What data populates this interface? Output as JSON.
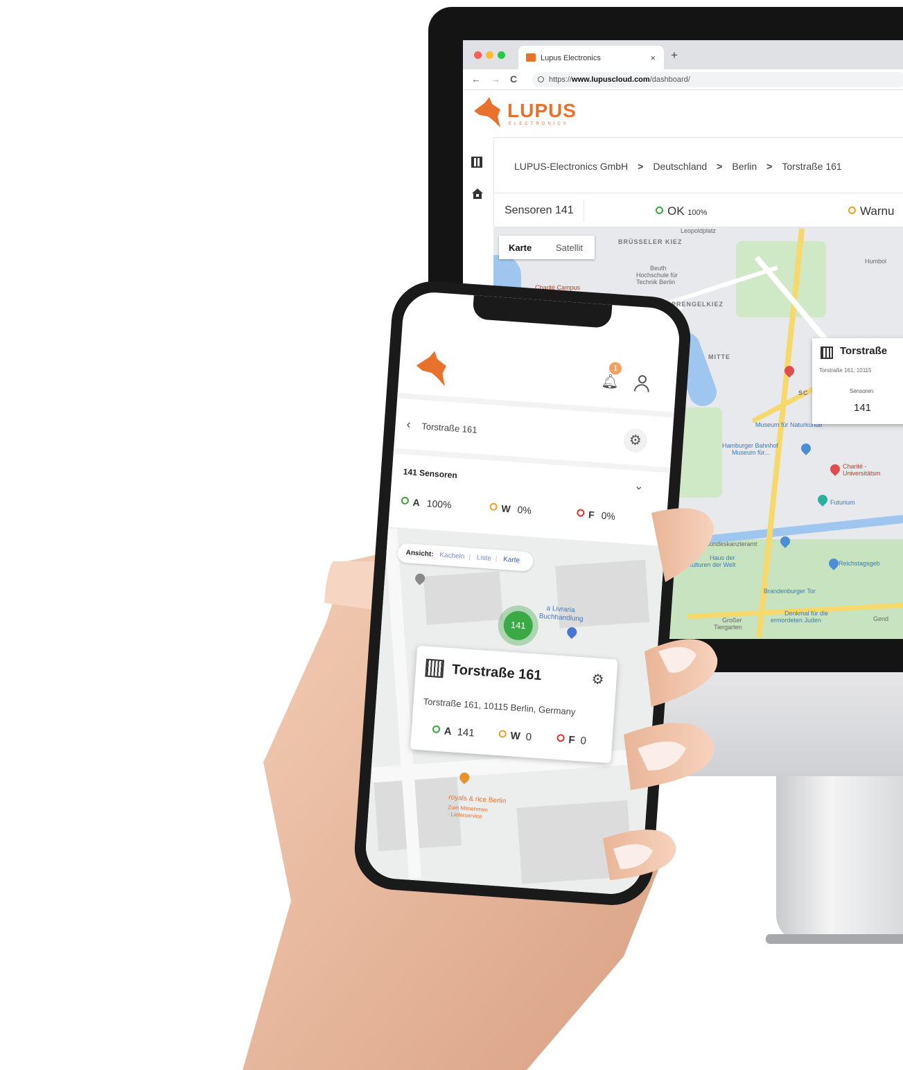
{
  "browser": {
    "tab_title": "Lupus Electronics",
    "tab_close": "×",
    "new_tab": "+",
    "url_prefix": "https://",
    "url_domain": "www.lupuscloud.com",
    "url_path": "/dashboard/",
    "back": "←",
    "forward": "→",
    "reload": "C"
  },
  "desktop": {
    "brand": "LUPUS",
    "brand_sub": "ELECTRONICS",
    "breadcrumb": [
      "LUPUS-Electronics GmbH",
      "Deutschland",
      "Berlin",
      "Torstraße 161"
    ],
    "breadcrumb_sep": ">",
    "sensoren_label": "Sensoren 141",
    "ok_label": "OK",
    "ok_value": "100%",
    "warn_label": "Warnu",
    "map_toggle": {
      "map": "Karte",
      "satellite": "Satellit"
    },
    "map_labels": {
      "leopoldplatz": "Leopoldplatz",
      "bruesseler_kiez": "BRÜSSELER KIEZ",
      "beuth1": "Beuth",
      "beuth2": "Hochschule für",
      "beuth3": "Technik Berlin",
      "charite_campus": "Charité Campus",
      "sprengelkiez": "SPRENGELKIEZ",
      "mitte": "MITTE",
      "humboldt": "Humbol",
      "sc": "SC",
      "museum": "Museum für Naturkunde",
      "hamburger1": "Hamburger Bahnhof",
      "hamburger2": "Museum für...",
      "charite1": "Charité -",
      "charite2": "Universitätsm",
      "futurium": "Futurium",
      "kanzleramt": "Bundeskanzleramt",
      "haus1": "Haus der",
      "haus2": "Kulturen der Welt",
      "reichstag": "Reichstagsgeb",
      "brandenburger": "Brandenburger Tor",
      "denkmal1": "Denkmal für die",
      "denkmal2": "ermordeten Juden",
      "grosser1": "Großer",
      "grosser2": "Tiergarten",
      "gend": "Gend"
    },
    "infocard": {
      "title": "Torstraße",
      "address": "Torstraße 161, 10115",
      "label": "Sensoren",
      "value": "141"
    }
  },
  "phone": {
    "notification_count": "1",
    "breadcrumb": "Torstraße 161",
    "sensors_title": "141 Sensoren",
    "stats": [
      {
        "letter": "A",
        "value": "100%",
        "color": "#3aa43a"
      },
      {
        "letter": "W",
        "value": "0%",
        "color": "#f0a020"
      },
      {
        "letter": "F",
        "value": "0%",
        "color": "#e0302a"
      }
    ],
    "view_label": "Ansicht:",
    "view_options": [
      "Kacheln",
      "Liste",
      "Karte"
    ],
    "cluster_count": "141",
    "card": {
      "title": "Torstraße 161",
      "address": "Torstraße 161, 10115 Berlin, Germany",
      "stats": [
        {
          "letter": "A",
          "value": "141",
          "color": "#3aa43a"
        },
        {
          "letter": "W",
          "value": "0",
          "color": "#f0a020"
        },
        {
          "letter": "F",
          "value": "0",
          "color": "#e0302a"
        }
      ]
    },
    "poi_libreria1": "a Livraria",
    "poi_libreria2": "Buchhandlung",
    "poi_royals1": "royals & rice Berlin",
    "poi_royals2": "Zum Mitnehmen",
    "poi_royals3": "· Lieferservice"
  },
  "colors": {
    "brand_orange": "#e8722c",
    "ok_green": "#3aa43a",
    "warn_orange": "#f0a020",
    "error_red": "#e0302a"
  }
}
